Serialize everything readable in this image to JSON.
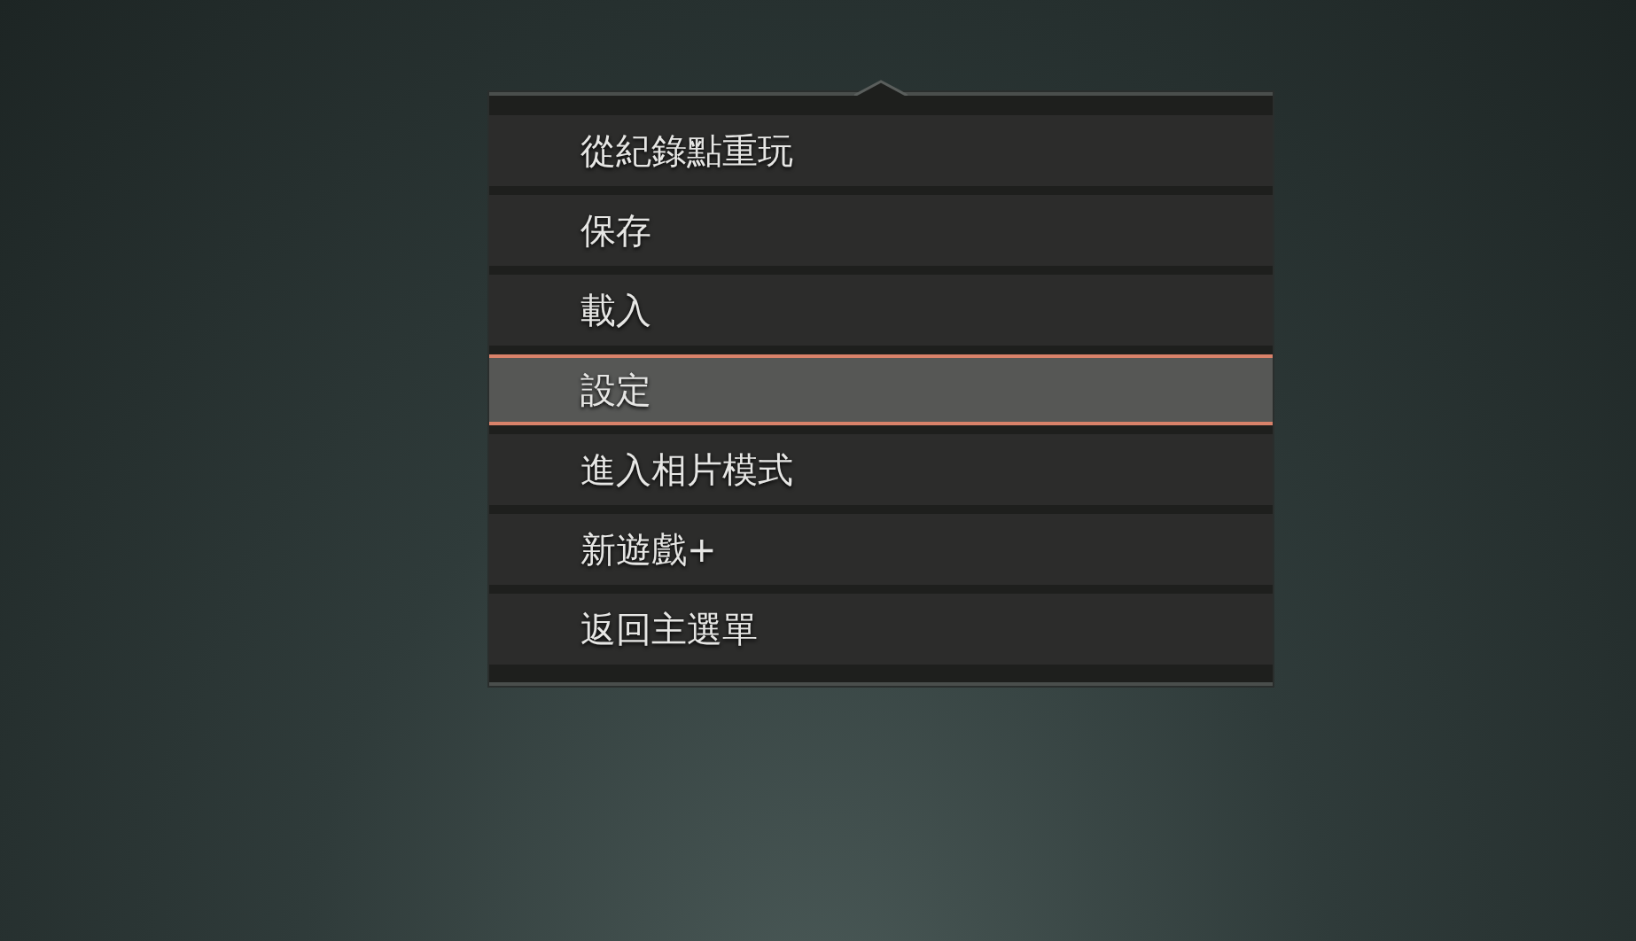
{
  "menu": {
    "items": [
      {
        "label": "從紀錄點重玩",
        "selected": false
      },
      {
        "label": "保存",
        "selected": false
      },
      {
        "label": "載入",
        "selected": false
      },
      {
        "label": "設定",
        "selected": true
      },
      {
        "label": "進入相片模式",
        "selected": false
      },
      {
        "label": "新遊戲+",
        "selected": false
      },
      {
        "label": "返回主選單",
        "selected": false
      }
    ]
  }
}
